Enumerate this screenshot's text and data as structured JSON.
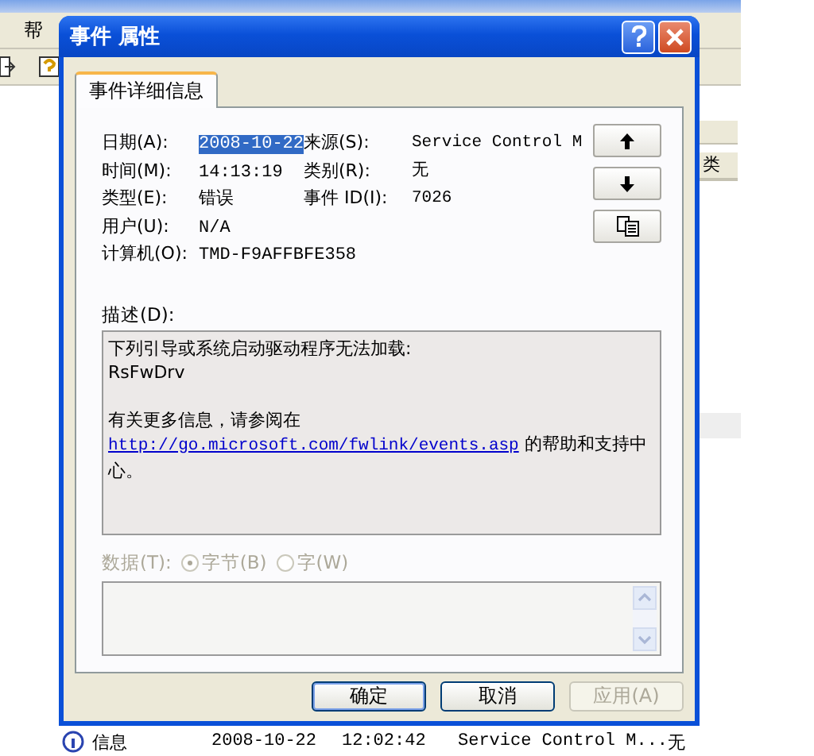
{
  "background_window": {
    "menu": [
      "帮"
    ],
    "header_fragment": "类",
    "row": {
      "type": "信息",
      "date": "2008-10-22",
      "time": "12:02:42",
      "source": "Service Control M...",
      "category": "无"
    }
  },
  "dialog": {
    "title": "事件 属性",
    "tabs": [
      {
        "label": "事件详细信息",
        "selected": true
      }
    ],
    "rows": [
      {
        "label": "日期(A):",
        "value": "2008-10-22",
        "value_selected": true,
        "right_label": "来源(S):",
        "right_value": "Service Control M"
      },
      {
        "label": "时间(M):",
        "value": "14:13:19",
        "value_selected": false,
        "right_label": "类别(R):",
        "right_value": "无"
      },
      {
        "label": "类型(E):",
        "value": "错误",
        "value_selected": false,
        "right_label": "事件 ID(I):",
        "right_value": "7026"
      },
      {
        "label": "用户(U):",
        "value": "N/A",
        "value_selected": false
      },
      {
        "label": "计算机(O):",
        "value": "TMD-F9AFFBFE358",
        "value_selected": false
      }
    ],
    "description": {
      "label": "描述(D):",
      "paragraphs": [
        {
          "lines": [
            {
              "kind": "text",
              "text": "下列引导或系统启动驱动程序无法加载:"
            },
            {
              "kind": "text",
              "text": "RsFwDrv"
            }
          ]
        },
        {
          "lines": [
            {
              "kind": "text",
              "text": "有关更多信息，请参阅在"
            },
            {
              "kind": "link",
              "link": "http://go.microsoft.com/fwlink/events.asp",
              "text": "的帮助和支持中心。"
            }
          ]
        }
      ]
    },
    "data": {
      "label": "数据(T):",
      "disabled": true,
      "options": [
        {
          "label": "字节(B)",
          "selected": true
        },
        {
          "label": "字(W)",
          "selected": false
        }
      ]
    },
    "buttons": [
      {
        "label": "确定",
        "disabled": false,
        "default": true
      },
      {
        "label": "取消",
        "disabled": false,
        "default": false
      },
      {
        "label": "应用(A)",
        "disabled": true,
        "default": false
      }
    ]
  }
}
